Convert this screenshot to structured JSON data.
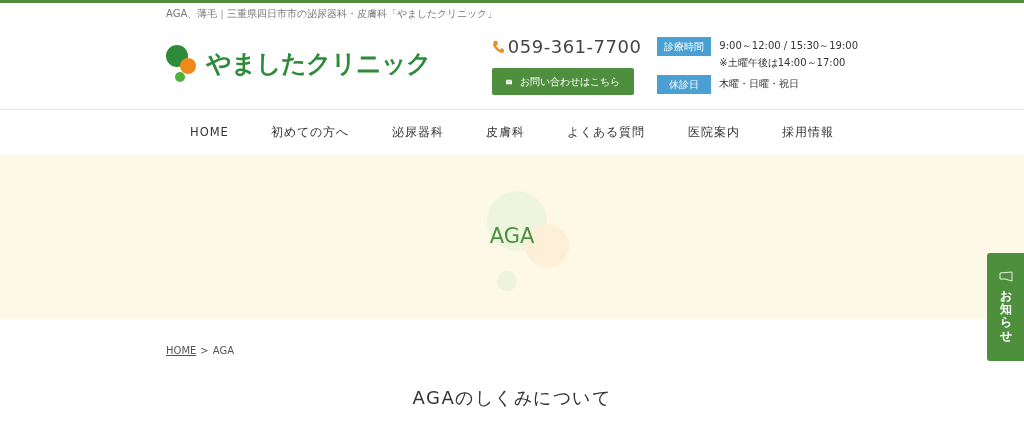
{
  "tagline": "AGA、薄毛｜三重県四日市市の泌尿器科・皮膚科「やましたクリニック」",
  "logo": {
    "text": "やましたクリニック"
  },
  "contact": {
    "phone": "059-361-7700",
    "button": "お問い合わせはこちら"
  },
  "hours": [
    {
      "label": "診療時間",
      "lines": [
        "9:00～12:00 / 15:30～19:00",
        "※土曜午後は14:00～17:00"
      ]
    },
    {
      "label": "休診日",
      "lines": [
        "木曜・日曜・祝日"
      ]
    }
  ],
  "nav": [
    {
      "label": "HOME"
    },
    {
      "label": "初めての方へ"
    },
    {
      "label": "泌尿器科"
    },
    {
      "label": "皮膚科"
    },
    {
      "label": "よくある質問"
    },
    {
      "label": "医院案内"
    },
    {
      "label": "採用情報"
    }
  ],
  "hero": {
    "title": "AGA"
  },
  "breadcrumb": [
    {
      "label": "HOME",
      "link": true
    },
    {
      "label": ">",
      "link": false
    },
    {
      "label": "AGA",
      "link": false
    }
  ],
  "section_heading": "AGAのしくみについて",
  "side_tab": {
    "label": "お知らせ"
  }
}
